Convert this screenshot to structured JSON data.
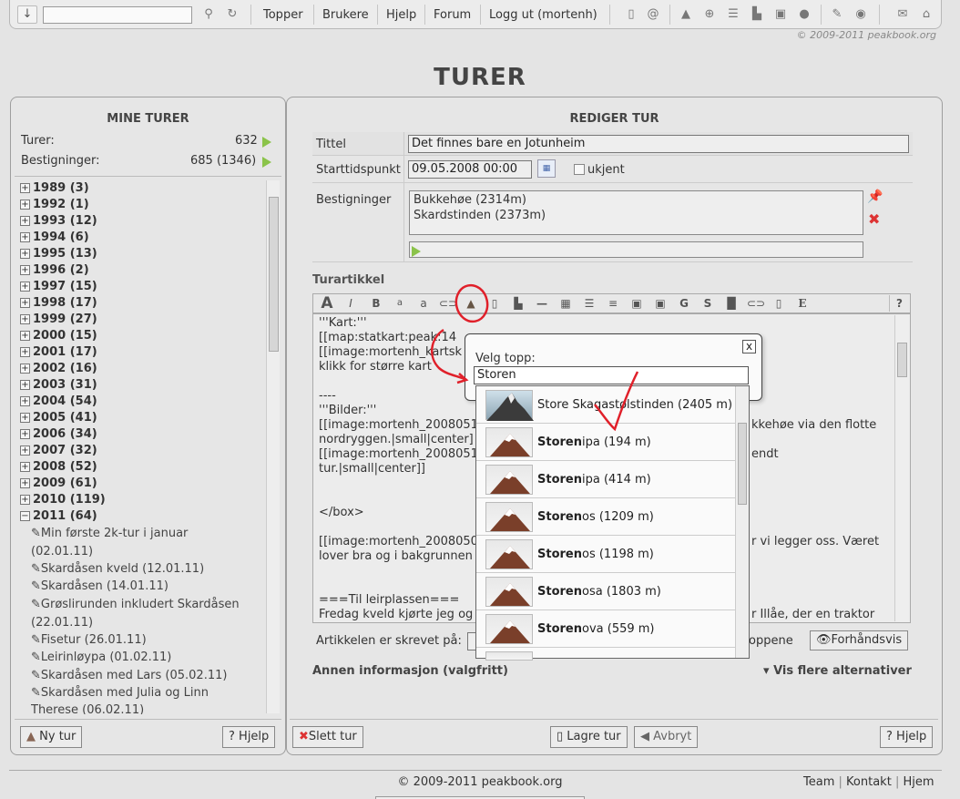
{
  "topbar": {
    "nav": [
      "Topper",
      "Brukere",
      "Hjelp",
      "Forum",
      "Logg ut (mortenh)"
    ],
    "search_value": "",
    "icons": [
      "download-icon",
      "search-icon",
      "refresh-icon",
      "document-icon",
      "email-at-icon",
      "mountain-icon",
      "plus-circle-icon",
      "list-icon",
      "boot-icon",
      "image-icon",
      "speech-bubble-icon",
      "pin-icon",
      "globe-icon",
      "mail-icon",
      "home-icon"
    ]
  },
  "copyright_top": "© 2009-2011 peakbook.org",
  "page_title": "TURER",
  "left": {
    "title": "MINE TURER",
    "turer_label": "Turer:",
    "turer_value": "632",
    "bestigninger_label": "Bestigninger:",
    "bestigninger_value": "685 (1346)",
    "years": [
      "1989 (3)",
      "1992 (1)",
      "1993 (12)",
      "1994 (6)",
      "1995 (13)",
      "1996 (2)",
      "1997 (15)",
      "1998 (17)",
      "1999 (27)",
      "2000 (15)",
      "2001 (17)",
      "2002 (16)",
      "2003 (31)",
      "2004 (54)",
      "2005 (41)",
      "2006 (34)",
      "2007 (32)",
      "2008 (52)",
      "2009 (61)",
      "2010 (119)",
      "2011 (64)"
    ],
    "trips": [
      {
        "line1": "Min første 2k-tur i januar",
        "line2": "(02.01.11)"
      },
      {
        "line1": "Skardåsen kveld (12.01.11)",
        "line2": ""
      },
      {
        "line1": "Skardåsen (14.01.11)",
        "line2": ""
      },
      {
        "line1": "Grøslirunden inkludert Skardåsen",
        "line2": "(22.01.11)"
      },
      {
        "line1": "Fisetur (26.01.11)",
        "line2": ""
      },
      {
        "line1": "Leirinløypa (01.02.11)",
        "line2": ""
      },
      {
        "line1": "Skardåsen med Lars (05.02.11)",
        "line2": ""
      },
      {
        "line1": "Skardåsen med Julia og Linn",
        "line2": "Therese (06.02.11)"
      }
    ],
    "new_trip_label": "Ny tur",
    "help_label": "Hjelp"
  },
  "right": {
    "title": "REDIGER TUR",
    "tittel_label": "Tittel",
    "tittel_value": "Det finnes bare en Jotunheim",
    "start_label": "Starttidspunkt",
    "start_value": "09.05.2008 00:00",
    "unknown_label": "ukjent",
    "bestigninger_label": "Bestigninger",
    "bestigninger_list": [
      "Bukkehøe (2314m)",
      "Skardstinden (2373m)"
    ],
    "artikkel_label": "Turartikkel",
    "editor_lines": [
      "'''Kart:'''",
      "[[map:statkart:peak:14",
      "[[image:mortenh_kartsk",
      "klikk for større kart",
      "",
      "----",
      "'''Bilder:'''",
      "[[image:mortenh_2008051",
      "nordryggen.|small|center]",
      "[[image:mortenh_2008051",
      "tur.|small|center]]",
      "",
      "",
      "</box>",
      "",
      "[[image:mortenh_2008050",
      "lover bra og i bakgrunnen",
      "",
      "",
      "===Til leirplassen===",
      "Fredag kveld kjørte jeg og"
    ],
    "editor_right_lines": [
      "kkehøe via den flotte",
      "",
      "endt",
      "",
      "",
      "r vi legger oss. Været",
      "",
      "",
      "",
      "r Illåe, der en traktor"
    ],
    "written_in_label": "Artikkelen er skrevet på:",
    "toppene_text": "oppene",
    "preview_label": "Forhåndsvis",
    "more_info_label": "Annen informasjon (valgfritt)",
    "more_options_label": "Vis flere alternativer",
    "delete_label": "Slett tur",
    "save_label": "Lagre tur",
    "cancel_label": "Avbryt",
    "help_label": "Hjelp"
  },
  "popup": {
    "title": "Velg topp:",
    "close_label": "x",
    "search_value": "Storen",
    "results": [
      {
        "bold": "",
        "rest": "Store Skagastølstinden (2405 m)"
      },
      {
        "bold": "Storen",
        "rest": "ipa (194 m)"
      },
      {
        "bold": "Storen",
        "rest": "ipa (414 m)"
      },
      {
        "bold": "Storen",
        "rest": "os (1209 m)"
      },
      {
        "bold": "Storen",
        "rest": "os (1198 m)"
      },
      {
        "bold": "Storen",
        "rest": "osa (1803 m)"
      },
      {
        "bold": "Storen",
        "rest": "ova (559 m)"
      }
    ]
  },
  "footer": {
    "copyright": "© 2009-2011 peakbook.org",
    "links": [
      "Team",
      "Kontakt",
      "Hjem"
    ]
  },
  "colors": {
    "accent_green": "#8bc34a",
    "annotation_red": "#e0202a",
    "panel_bg": "#e6e6e6"
  }
}
